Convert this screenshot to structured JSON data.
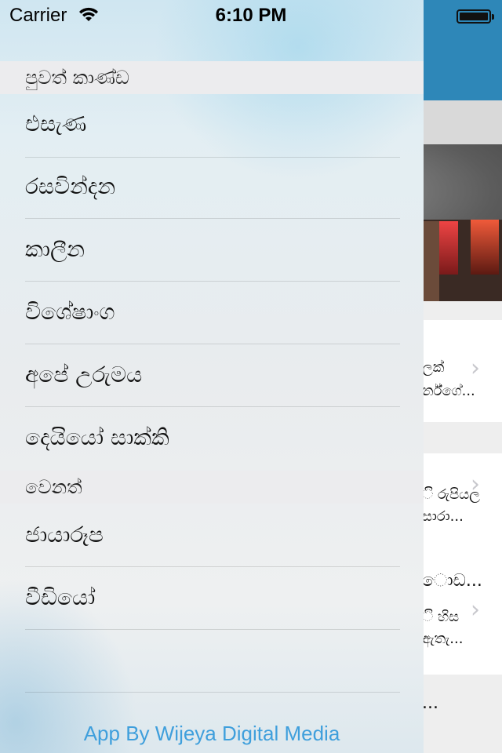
{
  "status_bar": {
    "carrier": "Carrier",
    "time": "6:10 PM"
  },
  "drawer": {
    "sections": [
      {
        "header": "පුවත් කාණ්ඩ",
        "items": [
          "එසැණ",
          "රසවින්දන",
          "කාලීන",
          "විශේෂාංග",
          "අපේ උරුමය",
          "දෙයියෝ සාක්කි"
        ]
      },
      {
        "header": "වෙනත්",
        "items": [
          "ජායාරූප",
          "වීඩියෝ"
        ]
      }
    ],
    "footer": "App By Wijeya Digital Media"
  },
  "background_articles": [
    {
      "line1": "ලක්",
      "line2": "ර්න්ගේ..."
    },
    {
      "line1": "ි රුපියල",
      "line2": "සාරා..."
    },
    {
      "line1": "ොඩ...",
      "line2": "ි හිස",
      "line3": "ඇතැ..."
    },
    {
      "line1": "..."
    }
  ],
  "icons": {
    "wifi": "wifi-icon",
    "battery": "battery-icon",
    "chevron": "chevron-right-icon"
  },
  "colors": {
    "nav_blue": "#2e87b8",
    "link_blue": "#3f9fdc"
  }
}
